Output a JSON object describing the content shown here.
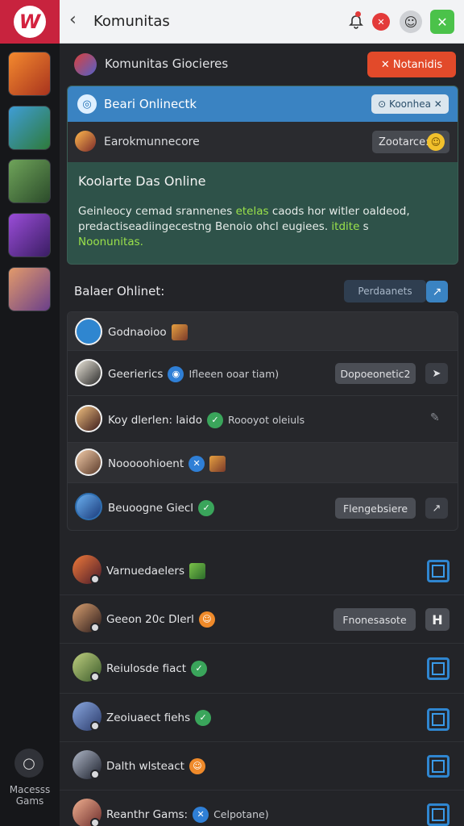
{
  "app": {
    "name": "Komunitas"
  },
  "sidebar": {
    "logo": "W",
    "games": [
      "game-1",
      "game-2",
      "game-3",
      "game-4",
      "game-5"
    ],
    "bottom_icon": "○",
    "bottom_label_1": "Macesss",
    "bottom_label_2": "Gams"
  },
  "topbar": {
    "back": "‹",
    "title": "Komunitas",
    "bell": "🔔",
    "red": "✕",
    "avatar": "☺",
    "green": "✕"
  },
  "header": {
    "title": "Komunitas Giocieres",
    "notif_button": "✕  Notanidis"
  },
  "card": {
    "top_title": "Beari Onlinectk",
    "top_pill": "⊙ Koonhea  ✕",
    "row_label": "Earokmunnecore",
    "row_pill": "Zootarce:",
    "heading": "Koolarte Das Online",
    "body_1": "Geinleocy cemad srannenes ",
    "body_green_1": "etelas",
    "body_2": " caods  hor witler oaldeod,",
    "body_3": "predactiseadiingecestng Benoio ohcl eugiees. ",
    "body_green_2": "itdite",
    "body_4": " s",
    "body_green_3": "Noonunitas."
  },
  "players": {
    "title": "Balaer Ohlinet:",
    "button": "Perdaanets",
    "icon": "↗",
    "rows": [
      {
        "label": "Godnaoioo",
        "badge": "",
        "extra": "",
        "pill": "",
        "btn": ""
      },
      {
        "label": "Geerierics",
        "badge": "◉",
        "extra": "Ifleeen ooar tiam)",
        "pill": "Dopoeonetic2",
        "btn": "➤"
      },
      {
        "label": "Koy dlerlen: laido",
        "badge": "✓",
        "extra": "Roooyot oleiuls",
        "pill": "",
        "btn": "✎"
      },
      {
        "label": "Nooooohioent",
        "badge": "✕",
        "extra": "",
        "pill": "",
        "btn": ""
      },
      {
        "label": "Beuoogne Giecl",
        "badge": "✓",
        "extra": "",
        "pill": "Flengebsiere",
        "btn": "↗"
      }
    ]
  },
  "list": [
    {
      "label": "Varnuedaelers",
      "badge": "",
      "pill": "",
      "btn": ""
    },
    {
      "label": "Geeon 20c Dlerl",
      "badge": "☺",
      "pill": "Fnonesasote",
      "btn": "H"
    },
    {
      "label": "Reiulosde fiact",
      "badge": "✓",
      "pill": "",
      "btn": ""
    },
    {
      "label": "Zeoiuaect fiehs",
      "badge": "✓",
      "pill": "",
      "btn": ""
    },
    {
      "label": "Dalth wlsteact",
      "badge": "☺",
      "pill": "",
      "btn": ""
    },
    {
      "label": "Reanthr Gams:",
      "badge": "✕",
      "extra": "Celpotane)",
      "pill": "",
      "btn": ""
    }
  ]
}
